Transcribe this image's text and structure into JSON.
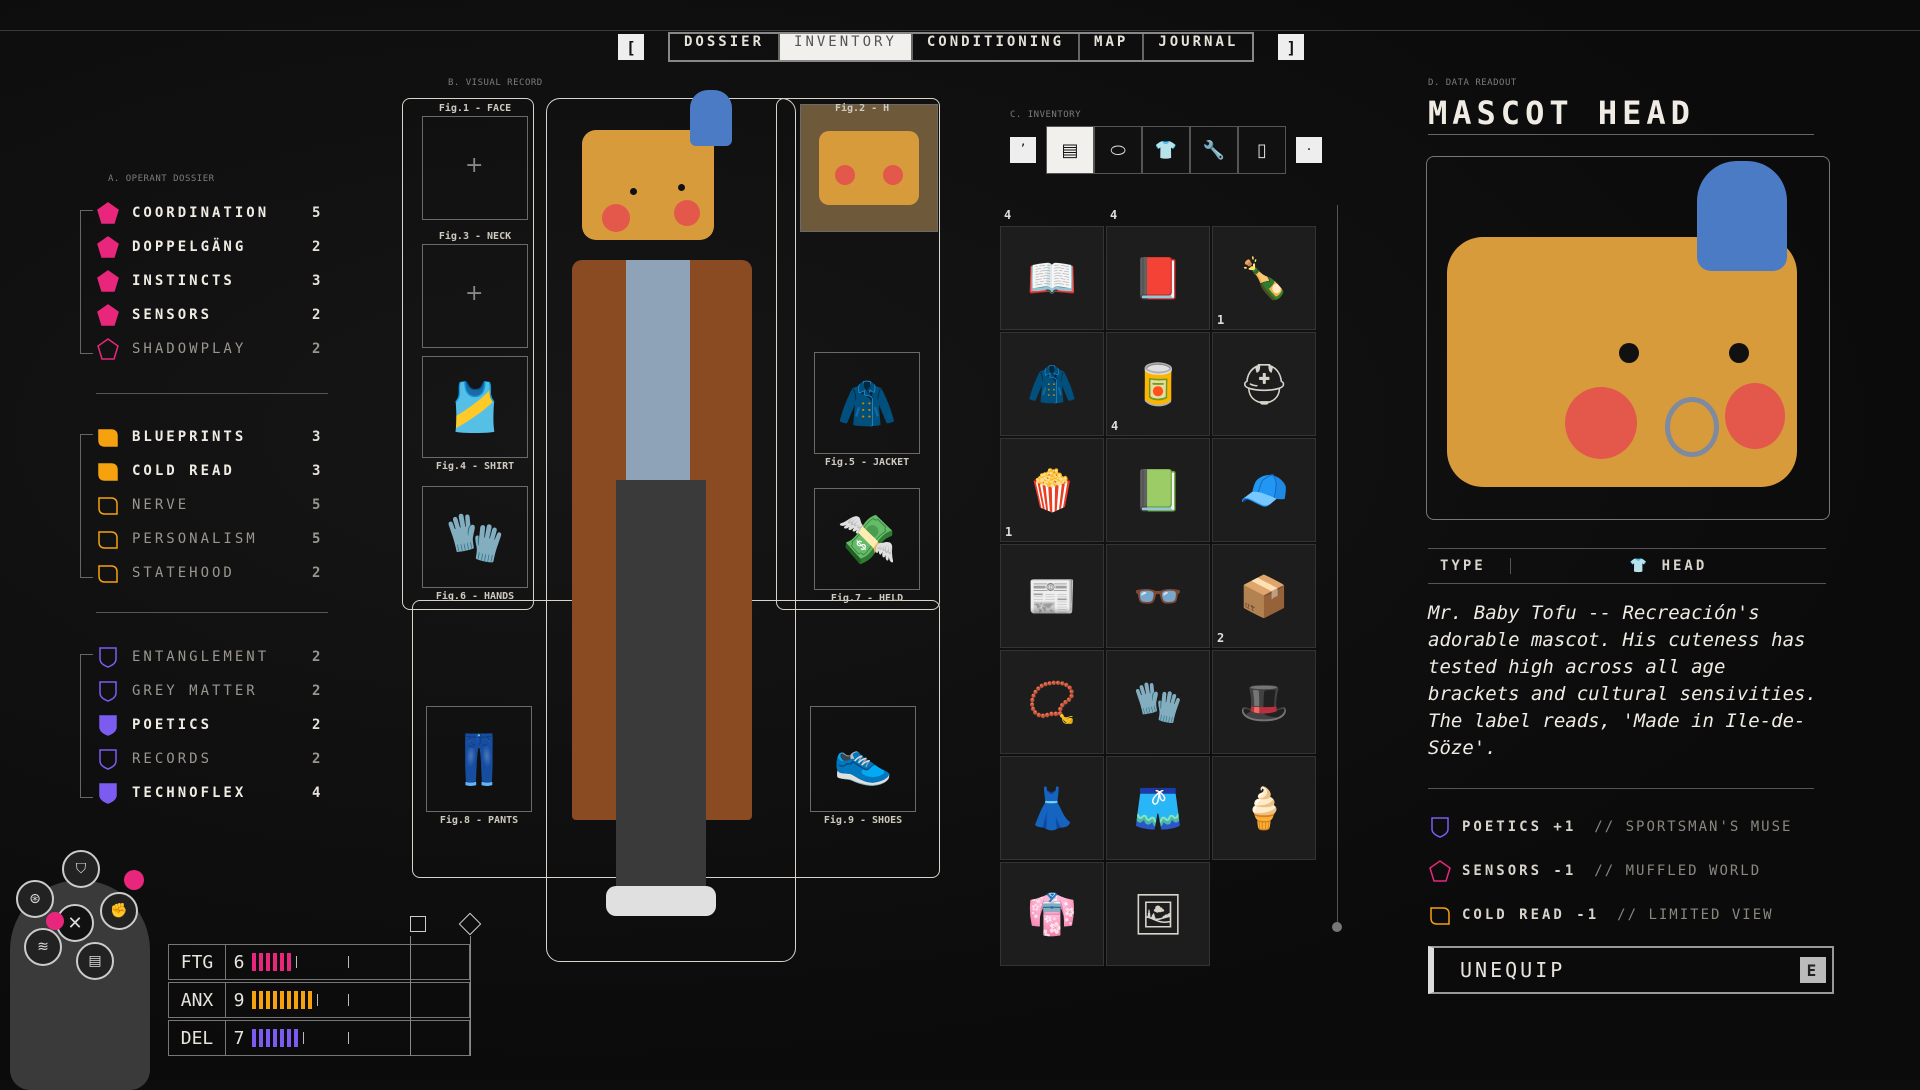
{
  "tabs": {
    "left_bracket": "[",
    "right_bracket": "]",
    "items": [
      {
        "label": "DOSSIER",
        "active": false
      },
      {
        "label": "INVENTORY",
        "active": true
      },
      {
        "label": "CONDITIONING",
        "active": false
      },
      {
        "label": "MAP",
        "active": false
      },
      {
        "label": "JOURNAL",
        "active": false
      }
    ]
  },
  "sections": {
    "dossier": "A. OPERANT DOSSIER",
    "visual": "B. VISUAL RECORD",
    "inventory": "C. INVENTORY",
    "readout": "D. DATA READOUT"
  },
  "stat_groups": [
    {
      "color": "#e8277c",
      "shape": "pentagon",
      "stats": [
        {
          "name": "COORDINATION",
          "value": "5",
          "filled": true
        },
        {
          "name": "DOPPELGÄNG",
          "value": "2",
          "filled": true
        },
        {
          "name": "INSTINCTS",
          "value": "3",
          "filled": true
        },
        {
          "name": "SENSORS",
          "value": "2",
          "filled": true
        },
        {
          "name": "SHADOWPLAY",
          "value": "2",
          "filled": false
        }
      ]
    },
    {
      "color": "#f5a20e",
      "shape": "leaf",
      "stats": [
        {
          "name": "BLUEPRINTS",
          "value": "3",
          "filled": true
        },
        {
          "name": "COLD READ",
          "value": "3",
          "filled": true
        },
        {
          "name": "NERVE",
          "value": "5",
          "filled": false
        },
        {
          "name": "PERSONALISM",
          "value": "5",
          "filled": false
        },
        {
          "name": "STATEHOOD",
          "value": "2",
          "filled": false
        }
      ]
    },
    {
      "color": "#7c5cf0",
      "shape": "shield",
      "stats": [
        {
          "name": "ENTANGLEMENT",
          "value": "2",
          "filled": false
        },
        {
          "name": "GREY MATTER",
          "value": "2",
          "filled": false
        },
        {
          "name": "POETICS",
          "value": "2",
          "filled": true
        },
        {
          "name": "RECORDS",
          "value": "2",
          "filled": false
        },
        {
          "name": "TECHNOFLEX",
          "value": "4",
          "filled": true
        }
      ]
    }
  ],
  "figures": {
    "face": "Fig.1 - FACE",
    "head": "Fig.2 - H",
    "neck": "Fig.3 - NECK",
    "shirt": "Fig.4 - SHIRT",
    "jacket": "Fig.5 - JACKET",
    "hands": "Fig.6 - HANDS",
    "held": "Fig.7 - HELD",
    "pants": "Fig.8 - PANTS",
    "shoes": "Fig.9 - SHOES"
  },
  "inventory": {
    "tools": [
      {
        "icon": "archive-icon",
        "glyph": "▤"
      },
      {
        "icon": "pill-icon",
        "glyph": "⬭"
      },
      {
        "icon": "shirt-icon",
        "glyph": "👕"
      },
      {
        "icon": "wrench-icon",
        "glyph": "🔧"
      },
      {
        "icon": "document-icon",
        "glyph": "▯"
      }
    ],
    "left_key": "’",
    "right_key": "·",
    "top_qty": [
      "4",
      "4",
      ""
    ],
    "items": [
      {
        "icon": "magazine-icon",
        "glyph": "📖",
        "qty": ""
      },
      {
        "icon": "magazine-icon",
        "glyph": "📕",
        "qty": ""
      },
      {
        "icon": "bottle-icon",
        "glyph": "🍾",
        "qty": "1"
      },
      {
        "icon": "jacket-icon",
        "glyph": "🧥",
        "qty": ""
      },
      {
        "icon": "can-icon",
        "glyph": "🥫",
        "qty": "4"
      },
      {
        "icon": "helmet-icon",
        "glyph": "⛑",
        "qty": ""
      },
      {
        "icon": "snack-bag-icon",
        "glyph": "🍿",
        "qty": "1"
      },
      {
        "icon": "book-icon",
        "glyph": "📗",
        "qty": ""
      },
      {
        "icon": "cap-icon",
        "glyph": "🧢",
        "qty": ""
      },
      {
        "icon": "newspaper-icon",
        "glyph": "📰",
        "qty": ""
      },
      {
        "icon": "glasses-icon",
        "glyph": "👓",
        "qty": ""
      },
      {
        "icon": "box-icon",
        "glyph": "📦",
        "qty": "2"
      },
      {
        "icon": "necklace-icon",
        "glyph": "📿",
        "qty": ""
      },
      {
        "icon": "gloves-icon",
        "glyph": "🧤",
        "qty": ""
      },
      {
        "icon": "hat-icon",
        "glyph": "🎩",
        "qty": ""
      },
      {
        "icon": "skirt-icon",
        "glyph": "👗",
        "qty": ""
      },
      {
        "icon": "shorts-icon",
        "glyph": "🩳",
        "qty": ""
      },
      {
        "icon": "ice-cream-icon",
        "glyph": "🍦",
        "qty": ""
      },
      {
        "icon": "skirt-purple-icon",
        "glyph": "👘",
        "qty": ""
      },
      {
        "icon": "photo-icon",
        "glyph": "🖼",
        "qty": ""
      }
    ]
  },
  "detail": {
    "title": "MASCOT HEAD",
    "type_label": "TYPE",
    "type_value": "HEAD",
    "description": "Mr. Baby Tofu -- Recreación's adorable mascot. His cuteness has tested high across all age brackets and cultural sensivities. The label reads, 'Made in Ile-de-Söze'.",
    "modifiers": [
      {
        "stat": "POETICS +1",
        "note": "// SPORTSMAN'S MUSE",
        "color": "#7c5cf0",
        "shape": "shield"
      },
      {
        "stat": "SENSORS -1",
        "note": "// MUFFLED WORLD",
        "color": "#e8277c",
        "shape": "pentagon"
      },
      {
        "stat": "COLD READ -1",
        "note": "// LIMITED VIEW",
        "color": "#f5a20e",
        "shape": "leaf"
      }
    ],
    "unequip_label": "UNEQUIP",
    "unequip_key": "E"
  },
  "meters": [
    {
      "label": "FTG",
      "value": "6",
      "segments": 6,
      "color": "#e8277c"
    },
    {
      "label": "ANX",
      "value": "9",
      "segments": 9,
      "color": "#f5a20e"
    },
    {
      "label": "DEL",
      "value": "7",
      "segments": 7,
      "color": "#7c5cf0"
    }
  ]
}
